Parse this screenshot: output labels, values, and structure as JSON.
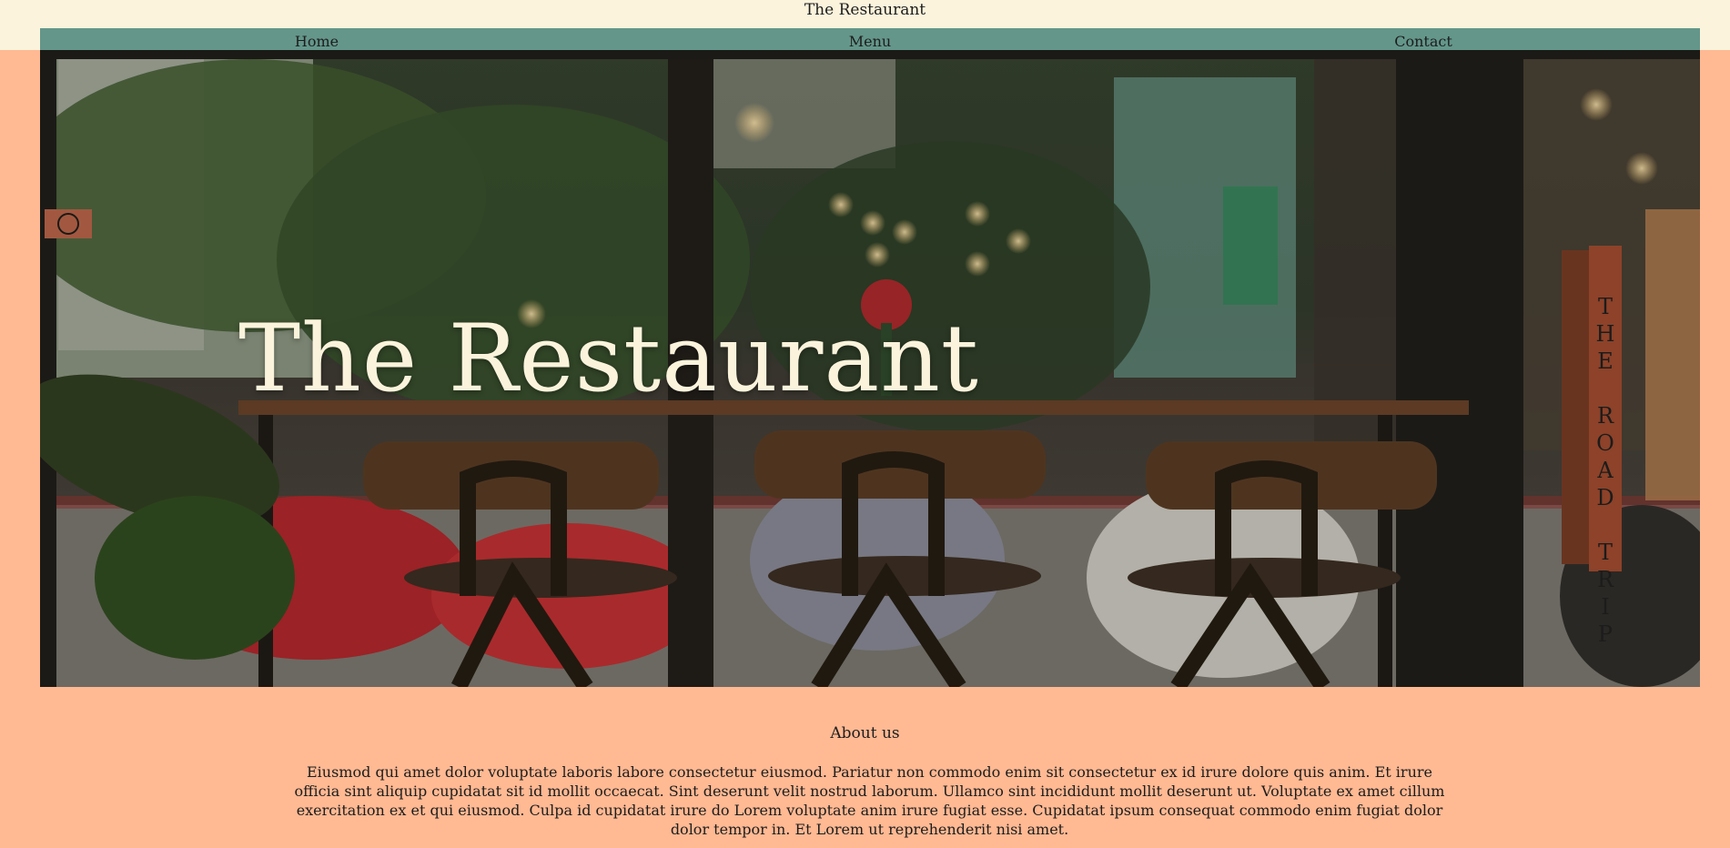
{
  "header": {
    "site_title": "The Restaurant",
    "nav": [
      {
        "label": "Home"
      },
      {
        "label": "Menu"
      },
      {
        "label": "Contact"
      }
    ]
  },
  "hero": {
    "title": "The Restaurant",
    "sign_text": "THE ROAD TRIP"
  },
  "about": {
    "heading": "About us",
    "body": "Eiusmod qui amet dolor voluptate laboris labore consectetur eiusmod. Pariatur non commodo enim sit consectetur ex id irure dolore quis anim. Et irure officia sint aliquip cupidatat sit id mollit occaecat. Sint deserunt velit nostrud laborum. Ullamco sint incididunt mollit deserunt ut. Voluptate ex amet cillum exercitation ex et qui eiusmod. Culpa id cupidatat irure do Lorem voluptate anim irure fugiat esse. Cupidatat ipsum consequat commodo enim fugiat dolor dolor tempor in. Et Lorem ut reprehenderit nisi amet."
  },
  "colors": {
    "page_background": "#ffb993",
    "header_background": "#fbf3dc",
    "nav_background": "#64968a",
    "hero_title": "#fbf3dc"
  }
}
